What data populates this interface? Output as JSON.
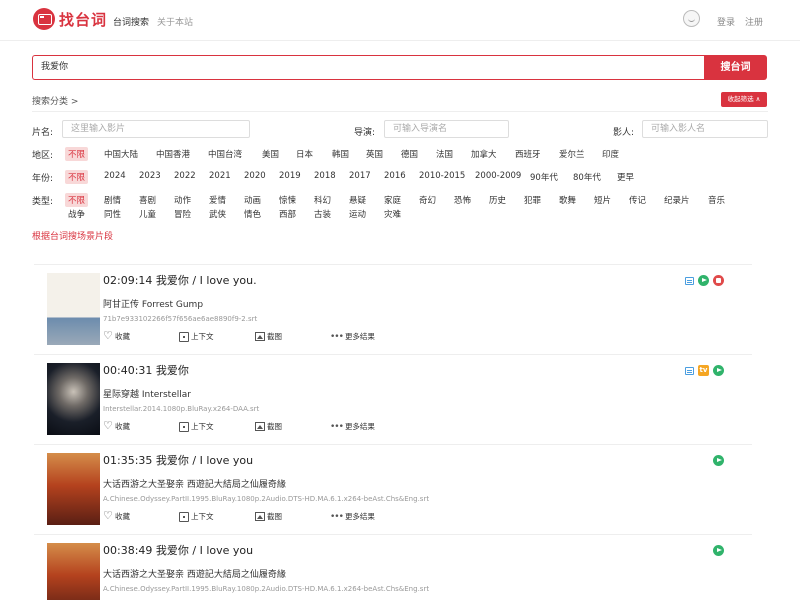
{
  "header": {
    "logo_text": "找台词",
    "nav": [
      "台词搜索",
      "关于本站"
    ],
    "login": "登录",
    "register": "注册"
  },
  "search": {
    "query": "我爱你",
    "button": "搜台词"
  },
  "filters": {
    "category_toggle": "搜索分类 >",
    "collapse": "收起筛选 ∧",
    "film_label": "片名:",
    "film_placeholder": "这里输入影片",
    "director_label": "导演:",
    "director_placeholder": "可输入导演名",
    "actor_label": "影人:",
    "actor_placeholder": "可输入影人名",
    "region_label": "地区:",
    "regions": [
      "不限",
      "中国大陆",
      "中国香港",
      "中国台湾",
      "美国",
      "日本",
      "韩国",
      "英国",
      "德国",
      "法国",
      "加拿大",
      "西班牙",
      "爱尔兰",
      "印度"
    ],
    "year_label": "年份:",
    "years": [
      "不限",
      "2024",
      "2023",
      "2022",
      "2021",
      "2020",
      "2019",
      "2018",
      "2017",
      "2016",
      "2010-2015",
      "2000-2009",
      "90年代",
      "80年代",
      "更早"
    ],
    "type_label": "类型:",
    "types_row1": [
      "不限",
      "剧情",
      "喜剧",
      "动作",
      "爱情",
      "动画",
      "惊悚",
      "科幻",
      "悬疑",
      "家庭",
      "奇幻",
      "恐怖",
      "历史",
      "犯罪",
      "歌舞",
      "短片",
      "传记",
      "纪录片",
      "音乐"
    ],
    "types_row2": [
      "战争",
      "同性",
      "儿童",
      "冒险",
      "武侠",
      "情色",
      "西部",
      "古装",
      "运动",
      "灾难"
    ],
    "scene_link": "根据台词搜场景片段"
  },
  "actions": {
    "favorite": "收藏",
    "context": "上下文",
    "screenshot": "截图",
    "more": "更多结果"
  },
  "results": [
    {
      "time_title": "02:09:14 我爱你 / I love you.",
      "movie": "阿甘正传 Forrest Gump",
      "file": "71b7e933102266f57f656ae6ae8890f9-2.srt"
    },
    {
      "time_title": "00:40:31 我爱你",
      "movie": "星际穿越 Interstellar",
      "file": "Interstellar.2014.1080p.BluRay.x264-DAA.srt"
    },
    {
      "time_title": "01:35:35 我爱你 / I love you",
      "movie": "大话西游之大圣娶亲 西遊記大結局之仙履奇緣",
      "file": "A.Chinese.Odyssey.PartII.1995.BluRay.1080p.2Audio.DTS-HD.MA.6.1.x264-beAst.Chs&Eng.srt"
    },
    {
      "time_title": "00:38:49 我爱你 / I love you",
      "movie": "大话西游之大圣娶亲 西遊記大結局之仙履奇緣",
      "file": "A.Chinese.Odyssey.PartII.1995.BluRay.1080p.2Audio.DTS-HD.MA.6.1.x264-beAst.Chs&Eng.srt"
    }
  ],
  "colors": {
    "accent": "#d9333f",
    "play": "#30b36b",
    "sub": "#4a9ee0"
  }
}
